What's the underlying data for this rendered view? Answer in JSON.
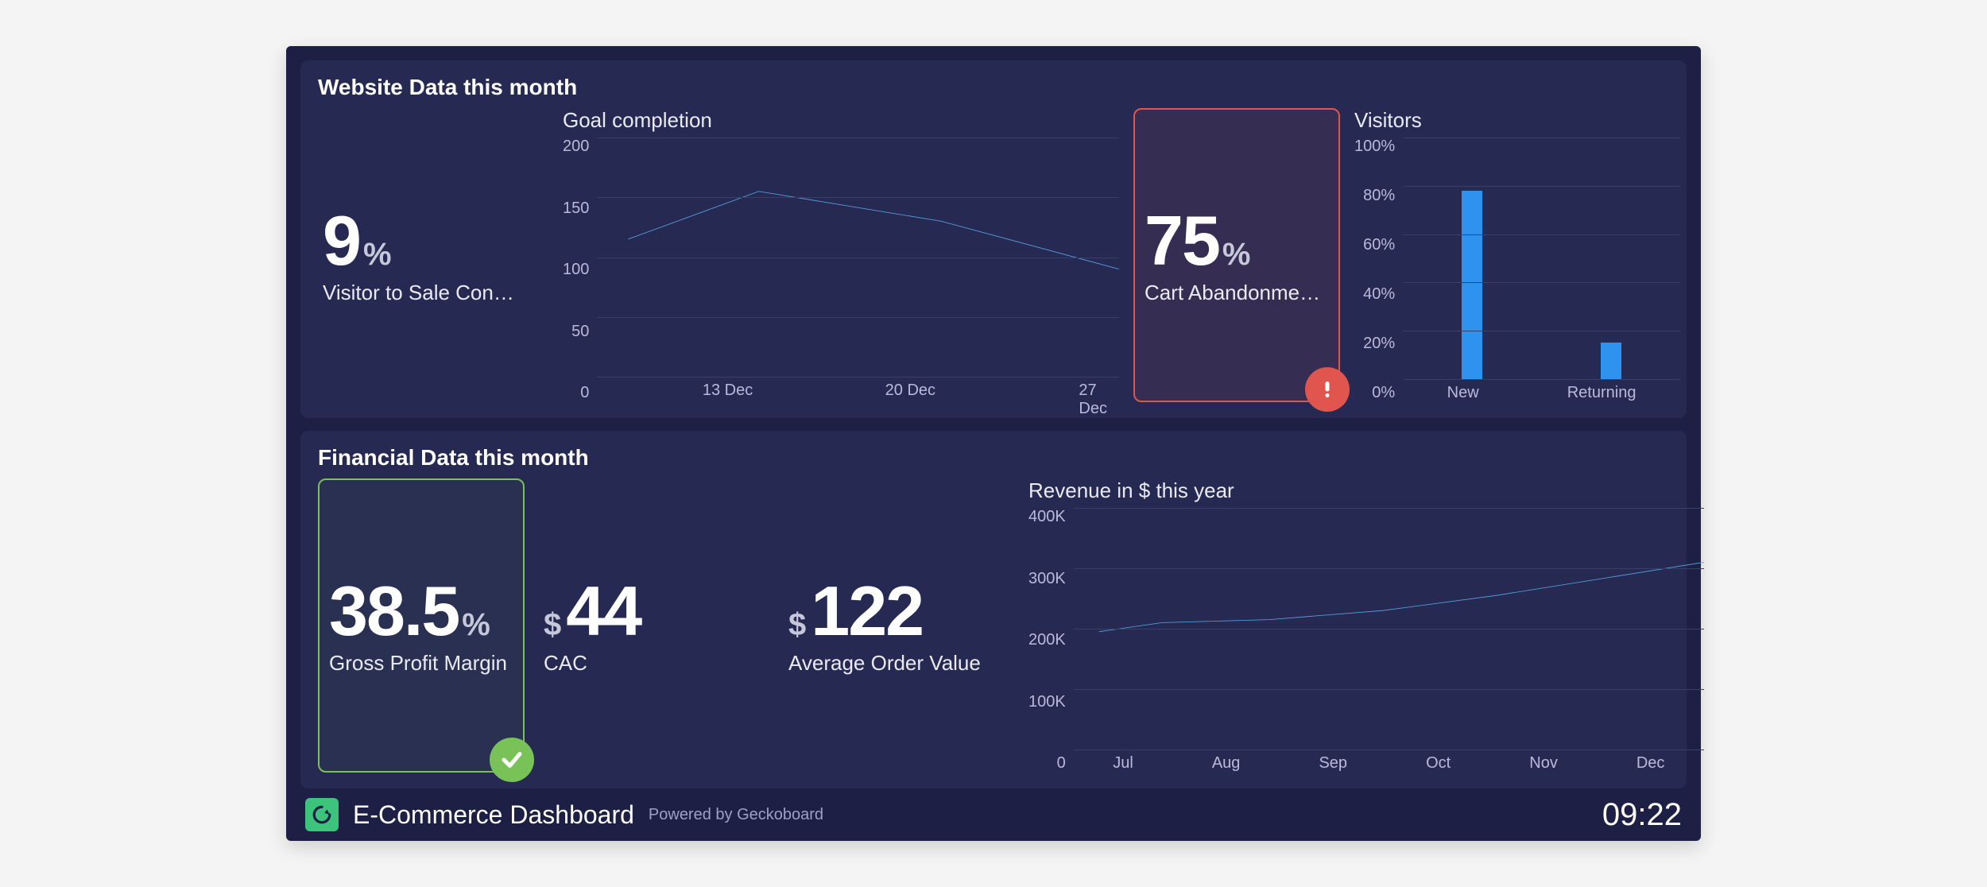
{
  "sections": {
    "website": {
      "title": "Website Data this month",
      "conversion": {
        "value": "9",
        "unit": "%",
        "label": "Visitor to Sale Con…"
      },
      "goal_chart_title": "Goal completion",
      "abandonment": {
        "value": "75",
        "unit": "%",
        "label": "Cart Abandonmen…"
      },
      "visitors_chart_title": "Visitors"
    },
    "financial": {
      "title": "Financial Data this month",
      "margin": {
        "value": "38.5",
        "unit": "%",
        "label": "Gross Profit Margin"
      },
      "cac": {
        "prefix": "$",
        "value": "44",
        "label": "CAC"
      },
      "aov": {
        "prefix": "$",
        "value": "122",
        "label": "Average Order Value"
      },
      "revenue_chart_title": "Revenue in $ this year"
    }
  },
  "footer": {
    "title": "E-Commerce Dashboard",
    "powered": "Powered by Geckoboard",
    "time": "09:22"
  },
  "chart_data": [
    {
      "id": "goal_completion",
      "type": "line",
      "title": "Goal completion",
      "x": [
        "13 Dec",
        "20 Dec",
        "27 Dec"
      ],
      "x_positions_pct": [
        25,
        60,
        95
      ],
      "series": [
        {
          "name": "Goal completion",
          "points": [
            [
              6,
              115
            ],
            [
              31,
              155
            ],
            [
              66,
              130
            ],
            [
              100,
              90
            ]
          ]
        }
      ],
      "y_ticks": [
        0,
        50,
        100,
        150,
        200
      ],
      "ylim": [
        0,
        200
      ],
      "xlabel": "",
      "ylabel": ""
    },
    {
      "id": "visitors",
      "type": "bar",
      "title": "Visitors",
      "categories": [
        "New",
        "Returning"
      ],
      "values": [
        78,
        15
      ],
      "y_ticks": [
        "0%",
        "20%",
        "40%",
        "60%",
        "80%",
        "100%"
      ],
      "ylim": [
        0,
        100
      ],
      "xlabel": "",
      "ylabel": ""
    },
    {
      "id": "revenue",
      "type": "line",
      "title": "Revenue in $ this year",
      "x": [
        "Jul",
        "Aug",
        "Sep",
        "Oct",
        "Nov",
        "Dec"
      ],
      "series": [
        {
          "name": "Revenue",
          "points": [
            [
              4,
              195000
            ],
            [
              14,
              210000
            ],
            [
              31,
              215000
            ],
            [
              49,
              230000
            ],
            [
              67,
              255000
            ],
            [
              85,
              285000
            ],
            [
              100,
              310000
            ]
          ]
        }
      ],
      "y_ticks": [
        "0",
        "100K",
        "200K",
        "300K",
        "400K"
      ],
      "ylim": [
        0,
        400000
      ],
      "xlabel": "",
      "ylabel": ""
    }
  ]
}
